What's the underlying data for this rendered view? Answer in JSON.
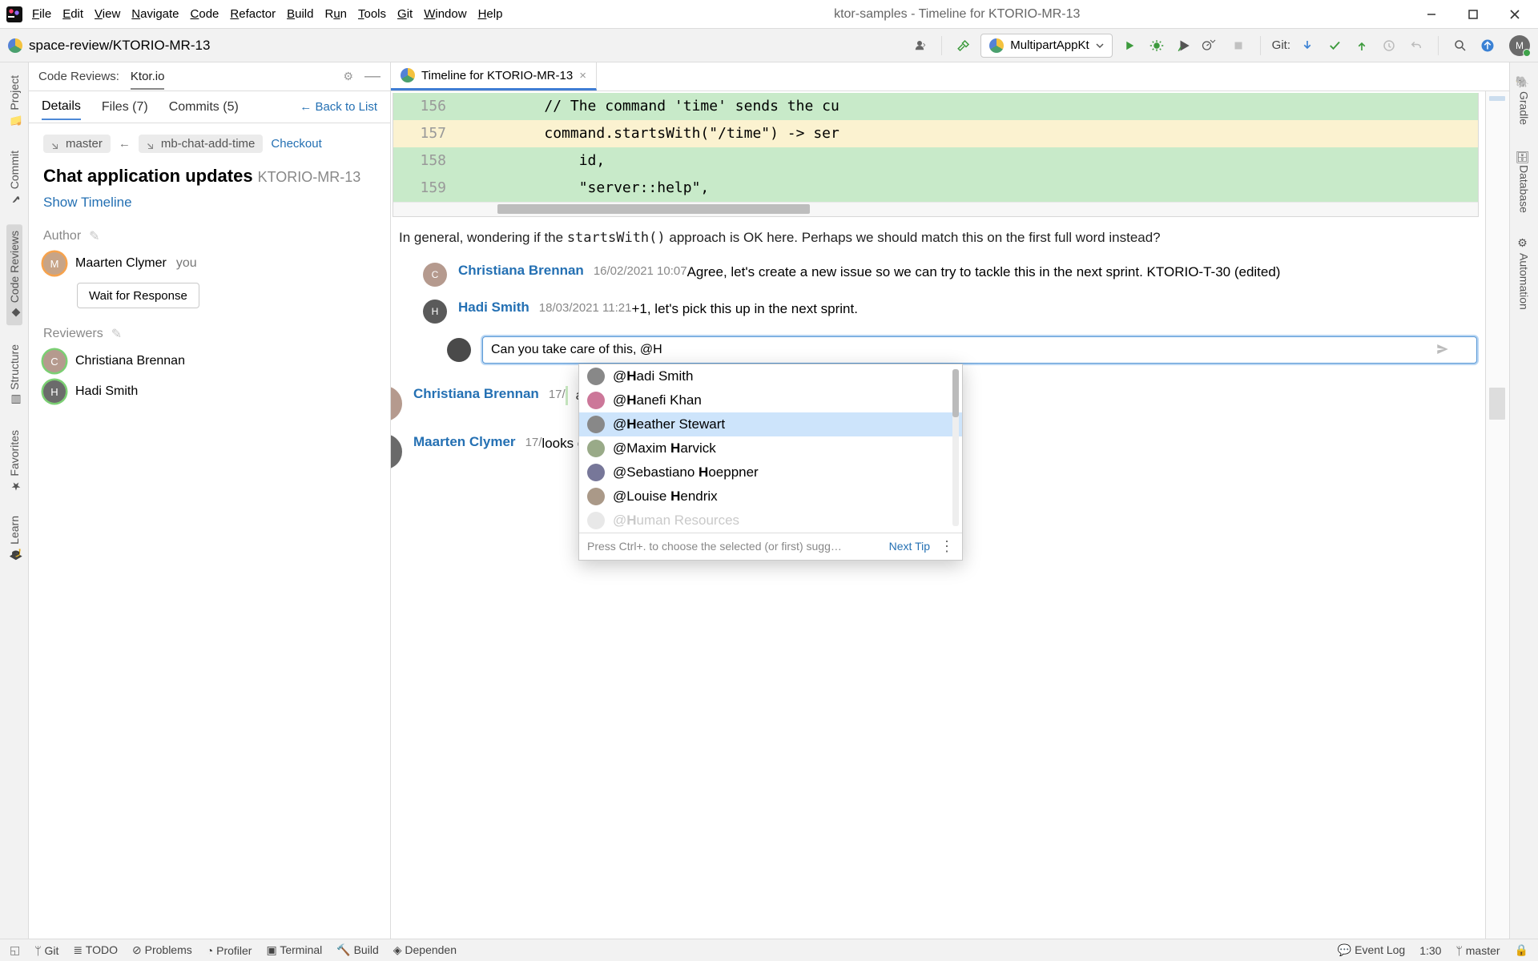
{
  "window": {
    "title": "ktor-samples - Timeline for KTORIO-MR-13",
    "menu": [
      "File",
      "Edit",
      "View",
      "Navigate",
      "Code",
      "Refactor",
      "Build",
      "Run",
      "Tools",
      "Git",
      "Window",
      "Help"
    ]
  },
  "navbar": {
    "breadcrumb": "space-review/KTORIO-MR-13",
    "run_config": "MultipartAppKt",
    "git_label": "Git:"
  },
  "left_gutter": [
    {
      "label": "Project",
      "active": false
    },
    {
      "label": "Commit",
      "active": false
    },
    {
      "label": "Code Reviews",
      "active": true
    },
    {
      "label": "Structure",
      "active": false
    },
    {
      "label": "Favorites",
      "active": false
    },
    {
      "label": "Learn",
      "active": false
    }
  ],
  "right_gutter": [
    {
      "label": "Gradle"
    },
    {
      "label": "Database"
    },
    {
      "label": "Automation"
    }
  ],
  "left_panel": {
    "header_title": "Code Reviews:",
    "header_link": "Ktor.io",
    "tabs": [
      {
        "label": "Details",
        "active": true
      },
      {
        "label": "Files (7)",
        "active": false
      },
      {
        "label": "Commits (5)",
        "active": false
      }
    ],
    "back": "← Back to List",
    "branches": {
      "from": "master",
      "arrow": "←",
      "to": "mb-chat-add-time",
      "checkout": "Checkout"
    },
    "title": "Chat application updates",
    "id": "KTORIO-MR-13",
    "show_timeline": "Show Timeline",
    "author_section": "Author",
    "author": {
      "name": "Maarten Clymer",
      "you": "you"
    },
    "wait_btn": "Wait for Response",
    "reviewers_section": "Reviewers",
    "reviewers": [
      {
        "name": "Christiana Brennan",
        "color": "#b59a8e"
      },
      {
        "name": "Hadi Smith",
        "color": "#6b6b6b"
      }
    ]
  },
  "editor": {
    "tab_title": "Timeline for KTORIO-MR-13",
    "diff": [
      {
        "n": "156",
        "cls": "green",
        "code": "          // The command 'time' sends the cu"
      },
      {
        "n": "157",
        "cls": "yellow",
        "code": "          command.startsWith(\"/time\") -> ser"
      },
      {
        "n": "158",
        "cls": "green",
        "code": "              id,"
      },
      {
        "n": "159",
        "cls": "green",
        "code": "              \"server::help\","
      }
    ],
    "root_comment_pre": "In general, wondering if the ",
    "root_comment_code": "startsWith()",
    "root_comment_post": " approach is OK here. Perhaps we should match this on the first full word instead?",
    "replies": [
      {
        "name": "Christiana Brennan",
        "ts": "16/02/2021 10:07",
        "text": "Agree, let's create a new issue so we can try to tackle this in the next sprint. KTORIO-T-30 (edited)"
      },
      {
        "name": "Hadi Smith",
        "ts": "18/03/2021 11:21",
        "text": "+1, let's pick this up in the next sprint."
      }
    ],
    "composer_value": "Can you take care of this, @H",
    "mention": {
      "items": [
        {
          "label": "@Hadi Smith",
          "match": "H"
        },
        {
          "label": "@Hanefi Khan",
          "match": "H"
        },
        {
          "label": "@Heather Stewart",
          "match": "H",
          "selected": true
        },
        {
          "label": "@Maxim Harvick",
          "match": "H"
        },
        {
          "label": "@Sebastiano Hoeppner",
          "match": "H"
        },
        {
          "label": "@Louise Hendrix",
          "match": "H"
        },
        {
          "label": "@Human Resources",
          "match": "H",
          "dim": true
        }
      ],
      "foot_hint": "Press Ctrl+. to choose the selected (or first) sugg…",
      "next_tip": "Next Tip"
    },
    "activity1": {
      "name": "Christiana Brennan",
      "ts": "17/",
      "text": "accepted the chan"
    },
    "activity2": {
      "name": "Maarten Clymer",
      "ts": "17/",
      "text": "looks good to me!"
    }
  },
  "status": {
    "items": [
      "Git",
      "TODO",
      "Problems",
      "Profiler",
      "Terminal",
      "Build",
      "Dependen"
    ],
    "event_log": "Event Log",
    "pos": "1:30",
    "branch": "master"
  },
  "colors": {
    "link": "#2470b3",
    "accent": "#3f7dd4",
    "diff_add": "#c8eac9",
    "diff_mod": "#fbf2d0"
  }
}
